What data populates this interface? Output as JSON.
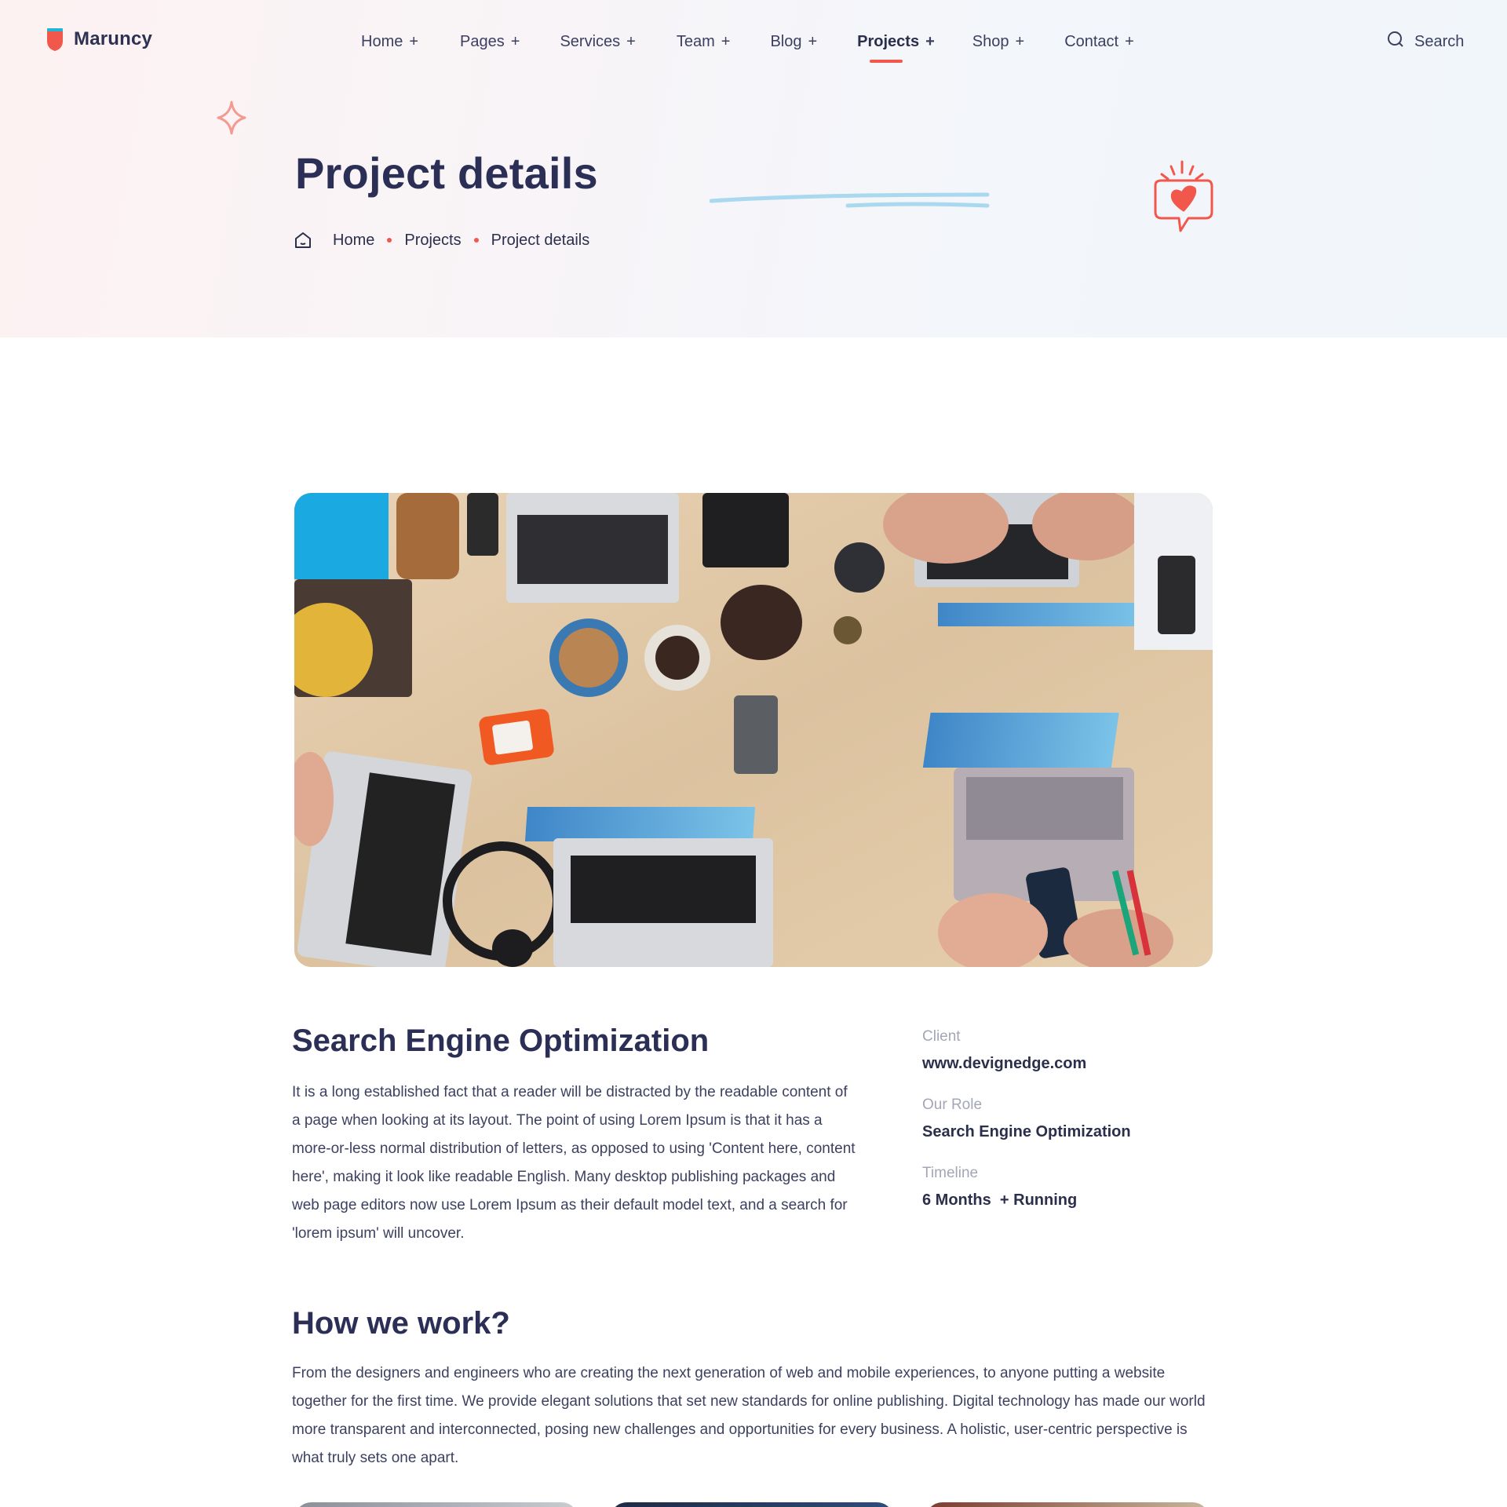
{
  "brand": {
    "name": "Maruncy"
  },
  "nav": {
    "items": [
      {
        "label": "Home",
        "plus": "+"
      },
      {
        "label": "Pages",
        "plus": "+"
      },
      {
        "label": "Services",
        "plus": "+"
      },
      {
        "label": "Team",
        "plus": "+"
      },
      {
        "label": "Blog",
        "plus": "+"
      },
      {
        "label": "Projects",
        "plus": "+"
      },
      {
        "label": "Shop",
        "plus": "+"
      },
      {
        "label": "Contact",
        "plus": "+"
      }
    ],
    "active": "Projects",
    "search_label": "Search"
  },
  "hero": {
    "title": "Project details",
    "breadcrumb": [
      "Home",
      "Projects",
      "Project details"
    ]
  },
  "project": {
    "title": "Search Engine Optimization",
    "description": "It is a long established fact that a reader will be distracted by the readable content of a page when looking at its layout. The point of using Lorem Ipsum is that it has a more-or-less normal distribution of letters, as opposed to using 'Content here, content here', making it look like readable English. Many desktop publishing packages and web page editors now use Lorem Ipsum as their default model text, and a search for 'lorem ipsum' will uncover.",
    "meta": {
      "client_label": "Client",
      "client_value": "www.devignedge.com",
      "role_label": "Our Role",
      "role_value": "Search Engine Optimization",
      "timeline_label": "Timeline",
      "timeline_value": "6 Months  + Running"
    }
  },
  "how": {
    "title": "How we work?",
    "text": "From the designers and engineers who are creating the next generation of web and mobile experiences, to anyone putting a website together for the first time. We provide elegant solutions that set new standards for online publishing. Digital technology has made our world more transparent and interconnected, posing new challenges and opportunities for every business. A holistic, user-centric perspective is what truly sets one apart."
  },
  "colors": {
    "accent": "#f2574b",
    "heading": "#2b2f55",
    "muted": "#a3a6b6"
  },
  "icons": {
    "logo": "shield-logo-icon",
    "search": "search-icon",
    "home": "home-icon",
    "sparkle": "sparkle-icon",
    "heart": "heart-bubble-icon"
  }
}
